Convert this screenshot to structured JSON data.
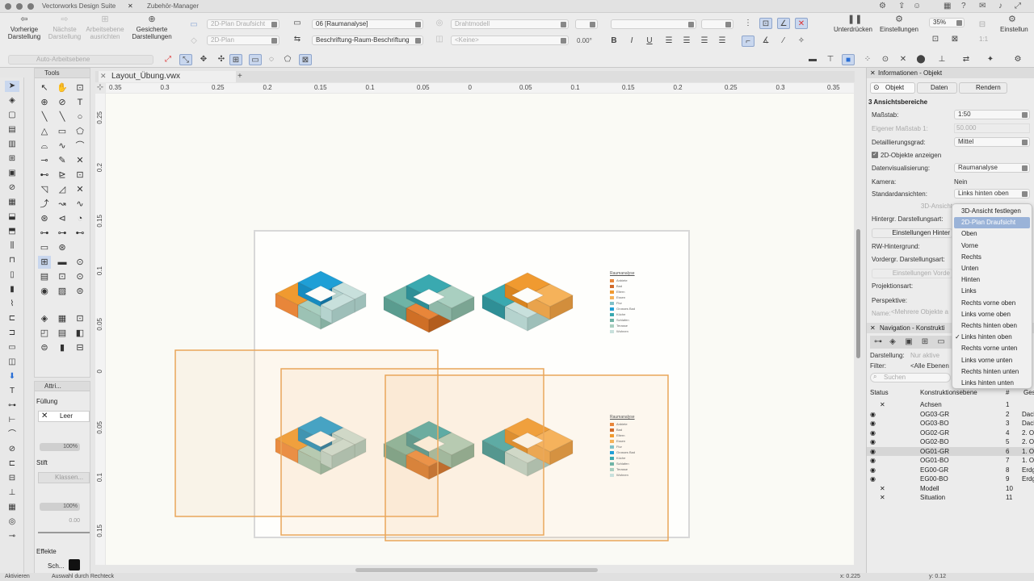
{
  "window": {
    "app_tab": "Vectorworks Design Suite",
    "second_tab": "Zubehör-Manager"
  },
  "toolbar": {
    "prev_view": "Vorherige Darstellung",
    "next_view": "Nächste Darstellung",
    "align_layer": "Arbeitsebene ausrichten",
    "saved_views": "Gesicherte Darstellungen",
    "view_mode": "2D-Plan Draufsicht",
    "plane": "2D-Plan",
    "class_select": "06 [Raumanalyse]",
    "label_select": "Beschriftung-Raum-Beschriftung",
    "render_mode": "Drahtmodell",
    "none_select": "<Keine>",
    "angle": "0.00°",
    "bold": "B",
    "italic": "I",
    "underline": "U",
    "suppress": "Unterdrücken",
    "settings": "Einstellungen",
    "zoom": "35%",
    "ratio": "1:1",
    "settings2": "Einstellun",
    "auto_layer": "Auto-Arbeitsebene"
  },
  "tools": {
    "palette_title": "Tools",
    "attr_title": "Attri...",
    "fill_label": "Füllung",
    "fill_value": "Leer",
    "pen_label": "Stift",
    "pen_class": "Klassen...",
    "opacity1": "100%",
    "opacity2": "100%",
    "pen_width": "0.00",
    "effects_label": "Effekte",
    "shadow_label": "Sch..."
  },
  "document": {
    "tab": "Layout_Übung.vwx",
    "ruler_top": [
      "0.35",
      "0.3",
      "0.25",
      "0.2",
      "0.15",
      "0.1",
      "0.05",
      "0",
      "0.05",
      "0.1",
      "0.15",
      "0.2",
      "0.25",
      "0.3",
      "0.35"
    ],
    "ruler_left": [
      "0.25",
      "0.2",
      "0.15",
      "0.1",
      "0.05",
      "0",
      "0.05",
      "0.1",
      "0.15"
    ]
  },
  "legend": {
    "title": "Raumanalyse",
    "items": [
      {
        "label": "Anbiete",
        "color": "#e8863a"
      },
      {
        "label": "Bad",
        "color": "#d06a2a"
      },
      {
        "label": "Eltern",
        "color": "#f09a30"
      },
      {
        "label": "Essen",
        "color": "#f5b25a"
      },
      {
        "label": "Flur",
        "color": "#7fc0c8"
      },
      {
        "label": "Grosses Bad",
        "color": "#1f9fd6"
      },
      {
        "label": "Küche",
        "color": "#3aa9b0"
      },
      {
        "label": "Schlafen",
        "color": "#6fb4a6"
      },
      {
        "label": "Terasse",
        "color": "#a9cfc0"
      },
      {
        "label": "Wohnen",
        "color": "#c8e0dc"
      }
    ]
  },
  "info_panel": {
    "title": "Informationen - Objekt",
    "tab_object": "Objekt",
    "tab_data": "Daten",
    "tab_render": "Rendern",
    "selection": "3 Ansichtsbereiche",
    "scale_label": "Maßstab:",
    "scale_value": "1:50",
    "own_scale_label": "Eigener Maßstab 1:",
    "own_scale_value": "50.000",
    "detail_label": "Detaillierungsgrad:",
    "detail_value": "Mittel",
    "show2d_label": "2D-Objekte anzeigen",
    "datavis_label": "Datenvisualisierung:",
    "datavis_value": "Raumanalyse",
    "camera_label": "Kamera:",
    "camera_value": "Nein",
    "stdviews_label": "Standardansichten:",
    "stdviews_value": "Links hinten oben",
    "view3d_btn": "3D-Ansicht",
    "bg_mode_label": "Hintergr. Darstellungsart:",
    "bg_settings_btn": "Einstellungen Hinter",
    "rw_bg_label": "RW-Hintergrund:",
    "fg_mode_label": "Vordergr. Darstellungsart:",
    "fg_settings_btn": "Einstellungen Vorde",
    "projection_label": "Projektionsart:",
    "perspective_label": "Perspektive:",
    "name_label": "Name:",
    "name_value": "<Mehrere Objekte a"
  },
  "dropdown_menu": {
    "items": [
      "3D-Ansicht festlegen",
      "2D-Plan Draufsicht",
      "Oben",
      "Vorne",
      "Rechts",
      "Unten",
      "Hinten",
      "Links",
      "Rechts vorne oben",
      "Links vorne oben",
      "Rechts hinten oben",
      "Links hinten oben",
      "Rechts vorne unten",
      "Links vorne unten",
      "Rechts hinten unten",
      "Links hinten unten"
    ],
    "highlighted": "2D-Plan Draufsicht",
    "checked": "Links hinten oben"
  },
  "navigation": {
    "title": "Navigation - Konstrukti",
    "display_label": "Darstellung:",
    "display_value": "Nur aktive",
    "filter_label": "Filter:",
    "filter_value": "<Alle Ebenen",
    "search_placeholder": "Suchen",
    "col_status": "Status",
    "col_layer": "Konstruktionsebene",
    "col_num": "#",
    "col_story": "Ges",
    "rows": [
      {
        "status": "x",
        "name": "Achsen",
        "num": "1",
        "story": ""
      },
      {
        "status": "eye",
        "name": "OG03-GR",
        "num": "2",
        "story": "Dach"
      },
      {
        "status": "eye",
        "name": "OG03-BO",
        "num": "3",
        "story": "Dach"
      },
      {
        "status": "eye",
        "name": "OG02-GR",
        "num": "4",
        "story": "2. OG"
      },
      {
        "status": "eye",
        "name": "OG02-BO",
        "num": "5",
        "story": "2. OG"
      },
      {
        "status": "eye",
        "name": "OG01-GR",
        "num": "6",
        "story": "1. OG"
      },
      {
        "status": "eye",
        "name": "OG01-BO",
        "num": "7",
        "story": "1. OG"
      },
      {
        "status": "eye",
        "name": "EG00-GR",
        "num": "8",
        "story": "Erdg"
      },
      {
        "status": "eye",
        "name": "EG00-BO",
        "num": "9",
        "story": "Erdg"
      },
      {
        "status": "x",
        "name": "Modell",
        "num": "10",
        "story": ""
      },
      {
        "status": "x",
        "name": "Situation",
        "num": "11",
        "story": ""
      }
    ]
  },
  "status_bar": {
    "left": "Aktivieren",
    "middle": "Auswahl durch Rechteck",
    "coord_x": "x: 0.225",
    "coord_y": "y: 0.12"
  }
}
